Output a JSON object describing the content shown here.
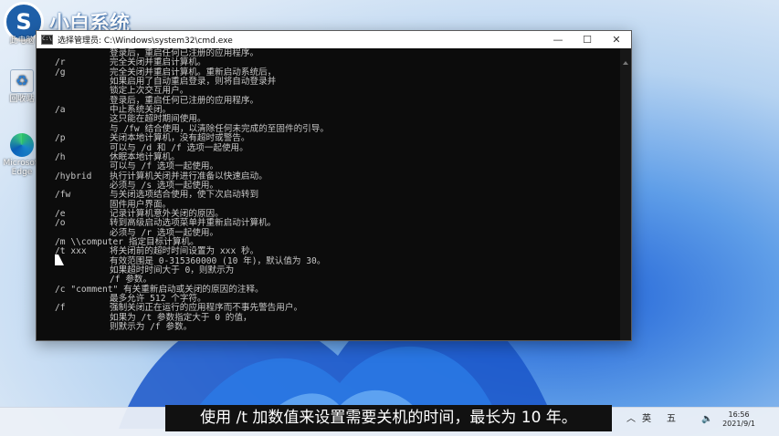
{
  "brand": {
    "name": "小白系统",
    "mark": "S"
  },
  "desktop_icons": [
    {
      "label": "此电脑",
      "icon": "this-pc-icon"
    },
    {
      "label": "回收站",
      "icon": "recycle-bin-icon"
    },
    {
      "label": "Microsoft Edge",
      "icon": "edge-icon"
    }
  ],
  "window": {
    "title": "选择管理员: C:\\Windows\\system32\\cmd.exe",
    "minimize": "—",
    "maximize": "☐",
    "close": "✕",
    "icon_text": "C:\\"
  },
  "console_lines": [
    [
      "",
      "登录后，重启任何已注册的应用程序。"
    ],
    [
      "/r",
      "完全关闭并重启计算机。"
    ],
    [
      "/g",
      "完全关闭并重启计算机。重新启动系统后，"
    ],
    [
      "",
      "如果启用了自动重启登录，则将自动登录并"
    ],
    [
      "",
      "锁定上次交互用户。"
    ],
    [
      "",
      "登录后，重启任何已注册的应用程序。"
    ],
    [
      "/a",
      "中止系统关闭。"
    ],
    [
      "",
      "这只能在超时期间使用。"
    ],
    [
      "",
      "与 /fw 结合使用，以清除任何未完成的至固件的引导。"
    ],
    [
      "/p",
      "关闭本地计算机，没有超时或警告。"
    ],
    [
      "",
      "可以与 /d 和 /f 选项一起使用。"
    ],
    [
      "/h",
      "休眠本地计算机。"
    ],
    [
      "",
      "可以与 /f 选项一起使用。"
    ],
    [
      "/hybrid",
      "执行计算机关闭并进行准备以快速启动。"
    ],
    [
      "",
      "必须与 /s 选项一起使用。"
    ],
    [
      "/fw",
      "与关闭选项结合使用，使下次启动转到"
    ],
    [
      "",
      "固件用户界面。"
    ],
    [
      "/e",
      "记录计算机意外关闭的原因。"
    ],
    [
      "/o",
      "转到高级启动选项菜单并重新启动计算机。"
    ],
    [
      "",
      "必须与 /r 选项一起使用。"
    ],
    [
      "/m \\\\computer 指定目标计算机。",
      ""
    ],
    [
      "/t xxx",
      "将关闭前的超时时间设置为 xxx 秒。"
    ],
    [
      "",
      "有效范围是 0-315360000 (10 年)，默认值为 30。"
    ],
    [
      "",
      "如果超时时间大于 0，则默示为"
    ],
    [
      "",
      "/f 参数。"
    ],
    [
      "/c \"comment\" 有关重新启动或关闭的原因的注释。",
      ""
    ],
    [
      "",
      "最多允许 512 个字符。"
    ],
    [
      "/f",
      "强制关闭正在运行的应用程序而不事先警告用户。"
    ],
    [
      "",
      "如果为 /t 参数指定大于 0 的值，"
    ],
    [
      "",
      "则默示为 /f 参数。"
    ]
  ],
  "subtitle": "使用 /t 加数值来设置需要关机的时间，最长为 10 年。",
  "tray": {
    "lang": "英",
    "ime": "五",
    "time": "16:56",
    "date": "2021/9/1"
  }
}
